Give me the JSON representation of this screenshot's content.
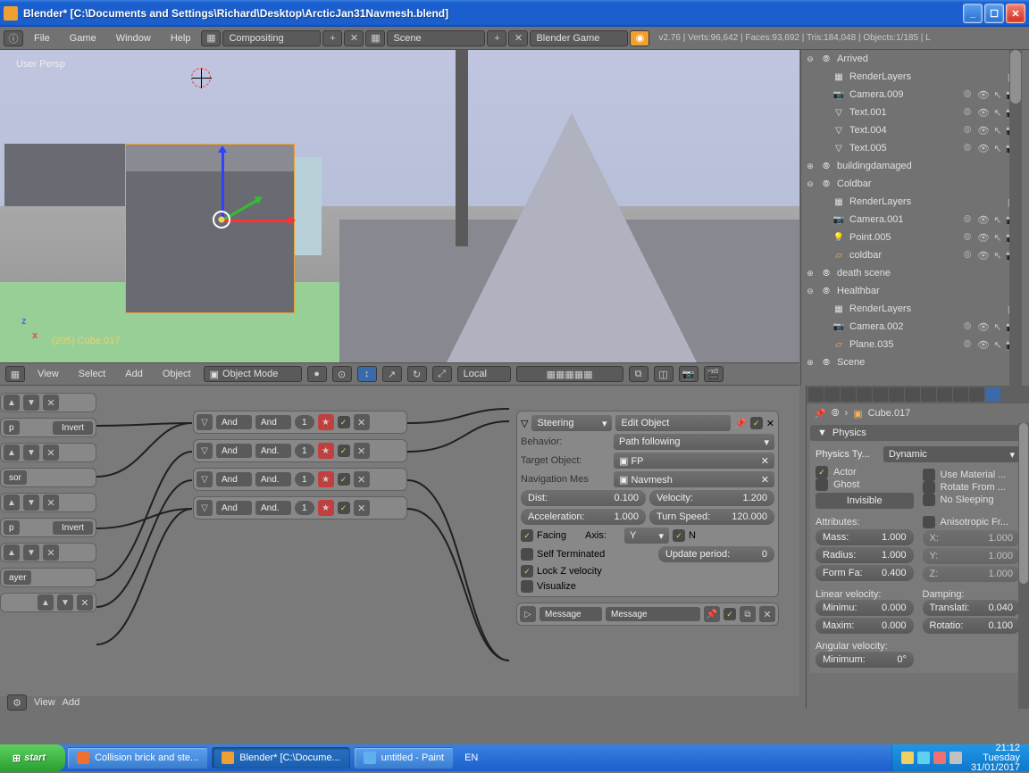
{
  "window": {
    "title": "Blender* [C:\\Documents and Settings\\Richard\\Desktop\\ArcticJan31Navmesh.blend]"
  },
  "menubar": {
    "items": [
      "File",
      "Game",
      "Window",
      "Help"
    ],
    "screen_layout": "Compositing",
    "scene": "Scene",
    "engine": "Blender Game",
    "stats": "v2.76 | Verts:96,642 | Faces:93,692 | Tris:184,048 | Objects:1/185 | L"
  },
  "viewport": {
    "label": "User Persp",
    "selected": "(205) Cube.017"
  },
  "vpheader": {
    "menus": [
      "View",
      "Select",
      "Add",
      "Object"
    ],
    "mode": "Object Mode",
    "orientation": "Local"
  },
  "outliner": {
    "items": [
      {
        "type": "scene",
        "name": "Arrived",
        "expanded": true,
        "ind": 0
      },
      {
        "type": "renderlayers",
        "name": "RenderLayers",
        "ind": 1
      },
      {
        "type": "camera",
        "name": "Camera.009",
        "ind": 1,
        "vis": true
      },
      {
        "type": "text",
        "name": "Text.001",
        "ind": 1,
        "vis": true
      },
      {
        "type": "text",
        "name": "Text.004",
        "ind": 1,
        "vis": true
      },
      {
        "type": "text",
        "name": "Text.005",
        "ind": 1,
        "vis": true
      },
      {
        "type": "scene",
        "name": "buildingdamaged",
        "expanded": false,
        "ind": 0
      },
      {
        "type": "scene",
        "name": "Coldbar",
        "expanded": true,
        "ind": 0
      },
      {
        "type": "renderlayers",
        "name": "RenderLayers",
        "ind": 1
      },
      {
        "type": "camera",
        "name": "Camera.001",
        "ind": 1,
        "vis": true
      },
      {
        "type": "lamp",
        "name": "Point.005",
        "ind": 1,
        "vis": true
      },
      {
        "type": "plane",
        "name": "coldbar",
        "ind": 1,
        "vis": true
      },
      {
        "type": "scene",
        "name": "death scene",
        "expanded": false,
        "ind": 0
      },
      {
        "type": "scene",
        "name": "Healthbar",
        "expanded": true,
        "ind": 0
      },
      {
        "type": "renderlayers",
        "name": "RenderLayers",
        "ind": 1
      },
      {
        "type": "camera",
        "name": "Camera.002",
        "ind": 1,
        "vis": true
      },
      {
        "type": "plane",
        "name": "Plane.035",
        "ind": 1,
        "vis": true
      },
      {
        "type": "scene",
        "name": "Scene",
        "expanded": false,
        "ind": 0
      }
    ]
  },
  "properties": {
    "breadcrumb": "Cube.017",
    "panel_title": "Physics",
    "physics_type_label": "Physics Ty...",
    "physics_type": "Dynamic",
    "checks_left": [
      {
        "label": "Actor",
        "on": true
      },
      {
        "label": "Ghost",
        "on": false
      }
    ],
    "checks_right": [
      {
        "label": "Use Material ...",
        "on": false
      },
      {
        "label": "Rotate From ...",
        "on": false
      },
      {
        "label": "No Sleeping",
        "on": false
      }
    ],
    "invisible_btn": "Invisible",
    "attributes_label": "Attributes:",
    "anisotropic_label": "Anisotropic Fr...",
    "mass": {
      "label": "Mass:",
      "val": "1.000"
    },
    "radius": {
      "label": "Radius:",
      "val": "1.000"
    },
    "formfa": {
      "label": "Form Fa:",
      "val": "0.400"
    },
    "aniso": [
      {
        "label": "X:",
        "val": "1.000"
      },
      {
        "label": "Y:",
        "val": "1.000"
      },
      {
        "label": "Z:",
        "val": "1.000"
      }
    ],
    "linvel_label": "Linear velocity:",
    "damping_label": "Damping:",
    "linvel": [
      {
        "label": "Minimu:",
        "val": "0.000"
      },
      {
        "label": "Maxim:",
        "val": "0.000"
      }
    ],
    "damping": [
      {
        "label": "Translati:",
        "val": "0.040"
      },
      {
        "label": "Rotatio:",
        "val": "0.100"
      }
    ],
    "angvel_label": "Angular velocity:",
    "angvel": {
      "label": "Minimum:",
      "val": "0°"
    }
  },
  "logic": {
    "left_bricks": [
      {
        "invert": true,
        "label": "p"
      },
      {
        "invert": false,
        "label": "sor"
      },
      {
        "invert": true,
        "label": "p"
      },
      {
        "invert": false,
        "label": "ayer"
      }
    ],
    "controllers": [
      {
        "type": "And",
        "name": "And",
        "num": "1"
      },
      {
        "type": "And",
        "name": "And.",
        "num": "1"
      },
      {
        "type": "And",
        "name": "And.",
        "num": "1"
      },
      {
        "type": "And",
        "name": "And.",
        "num": "1"
      }
    ],
    "actuator": {
      "type": "Steering",
      "name": "Edit Object",
      "behavior_label": "Behavior:",
      "behavior": "Path following",
      "target_label": "Target Object:",
      "target": "FP",
      "navmesh_label": "Navigation Mes",
      "navmesh": "Navmesh",
      "dist_label": "Dist:",
      "dist": "0.100",
      "velocity_label": "Velocity:",
      "velocity": "1.200",
      "accel_label": "Acceleration:",
      "accel": "1.000",
      "turn_label": "Turn Speed:",
      "turn": "120.000",
      "facing_label": "Facing",
      "axis_label": "Axis:",
      "axis": "Y",
      "n_label": "N",
      "selfterm_label": "Self Terminated",
      "update_label": "Update period:",
      "update": "0",
      "lockz_label": "Lock Z velocity",
      "visualize_label": "Visualize"
    },
    "message_brick": {
      "type": "Message",
      "name": "Message"
    },
    "footer_menus": [
      "View",
      "Add"
    ]
  },
  "taskbar": {
    "start": "start",
    "tasks": [
      {
        "label": "Collision brick and ste...",
        "active": false,
        "icon": "#f07030"
      },
      {
        "label": "Blender* [C:\\Docume...",
        "active": true,
        "icon": "#f0a030"
      },
      {
        "label": "untitled - Paint",
        "active": false,
        "icon": "#60b0f0"
      }
    ],
    "lang": "EN",
    "time": "21:12",
    "day": "Tuesday",
    "date": "31/01/2017"
  }
}
